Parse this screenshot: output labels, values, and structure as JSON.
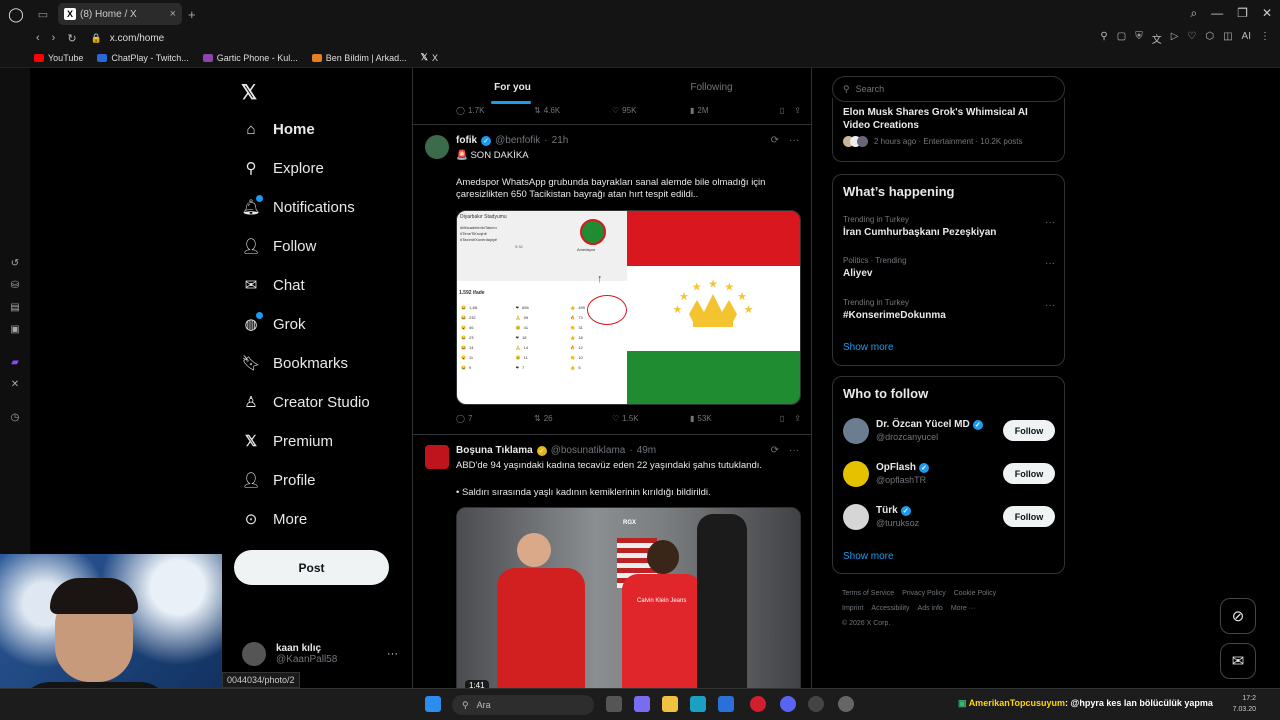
{
  "browser": {
    "tab_title": "(8) Home / X",
    "url": "x.com/home",
    "bookmarks": [
      "YouTube",
      "ChatPlay - Twitch...",
      "Gartic Phone - Kul...",
      "Ben Bildim | Arkad...",
      "X"
    ],
    "ai_label": "AI"
  },
  "nav": {
    "items": [
      {
        "label": "Home"
      },
      {
        "label": "Explore"
      },
      {
        "label": "Notifications"
      },
      {
        "label": "Follow"
      },
      {
        "label": "Chat"
      },
      {
        "label": "Grok"
      },
      {
        "label": "Bookmarks"
      },
      {
        "label": "Creator Studio"
      },
      {
        "label": "Premium"
      },
      {
        "label": "Profile"
      },
      {
        "label": "More"
      }
    ],
    "post_label": "Post",
    "account": {
      "name": "kaan kılıç",
      "handle": "@KaanPall58"
    }
  },
  "feed": {
    "tabs": [
      "For you",
      "Following"
    ],
    "top_actions": {
      "replies": "1.7K",
      "reposts": "4.6K",
      "likes": "95K",
      "views": "2M"
    },
    "tweets": [
      {
        "name": "fofik",
        "handle": "@benfofik",
        "time": "21h",
        "line1": "🚨 SON DAKİKA",
        "text": "Amedspor WhatsApp grubunda bayrakları sanal alemde bile olmadığı için çaresizlikten 650 Tacikistan bayrağı atan hırt tespit edildi..",
        "replies": "7",
        "reposts": "26",
        "likes": "1.5K",
        "views": "53K",
        "shot": {
          "header": "Diyarbakır Stadyumu",
          "tags": [
            "#MücadeleninTakımı",
            "#TimeTiKroşhê",
            "#TaxımêXoverdayiyê"
          ],
          "club": "Amedspor",
          "count": "1.592 ifade",
          "reactions": [
            "1,4B",
            "656",
            "499",
            "232",
            "95",
            "73",
            "46",
            "41",
            "31",
            "23",
            "18",
            "18",
            "14",
            "14",
            "12",
            "11",
            "11",
            "10",
            "9",
            "7",
            "5"
          ],
          "clock": "9:32"
        }
      },
      {
        "name": "Boşuna Tıklama",
        "handle": "@bosunatiklama",
        "time": "49m",
        "line1": "ABD'de 94 yaşındaki kadına tecavüz eden 22 yaşındaki şahıs tutuklandı.",
        "text": "• Saldırı sırasında yaşlı kadının kemiklerinin kırıldığı bildirildi.",
        "video_duration": "1:41",
        "video_tag": "RGX",
        "shirt_text": "Calvin Klein Jeans"
      }
    ]
  },
  "right": {
    "search_placeholder": "Search",
    "news": {
      "title": "Elon Musk Shares Grok's Whimsical AI Video Creations",
      "meta": "2 hours ago · Entertainment · 10.2K posts"
    },
    "happening_title": "What’s happening",
    "trends": [
      {
        "meta": "Trending in Turkey",
        "title": "İran Cumhurbaşkanı Pezeşkiyan"
      },
      {
        "meta": "Politics · Trending",
        "title": "Aliyev"
      },
      {
        "meta": "Trending in Turkey",
        "title": "#KonserimeDokunma"
      }
    ],
    "show_more": "Show more",
    "wtf_title": "Who to follow",
    "follow_label": "Follow",
    "who_to_follow": [
      {
        "name": "Dr. Özcan Yücel MD",
        "handle": "@drozcanyucel"
      },
      {
        "name": "OpFlash",
        "handle": "@opflashTR"
      },
      {
        "name": "Türk",
        "handle": "@turuksoz"
      }
    ],
    "footer": [
      "Terms of Service",
      "Privacy Policy",
      "Cookie Policy",
      "Imprint",
      "Accessibility",
      "Ads info",
      "More ···",
      "© 2026 X Corp."
    ]
  },
  "status_url": "0044034/photo/2",
  "taskbar": {
    "search": "Ara",
    "chat_user": "AmerikanTopcusuyum",
    "chat_msg": ": @hpyra kes lan bölücülük yapma",
    "time": "17:2",
    "date": "7.03.20"
  },
  "colors": {
    "accent": "#1d9bf0",
    "flag_red": "#d8181e",
    "flag_green": "#1f8c31",
    "crown": "#f4c430"
  }
}
